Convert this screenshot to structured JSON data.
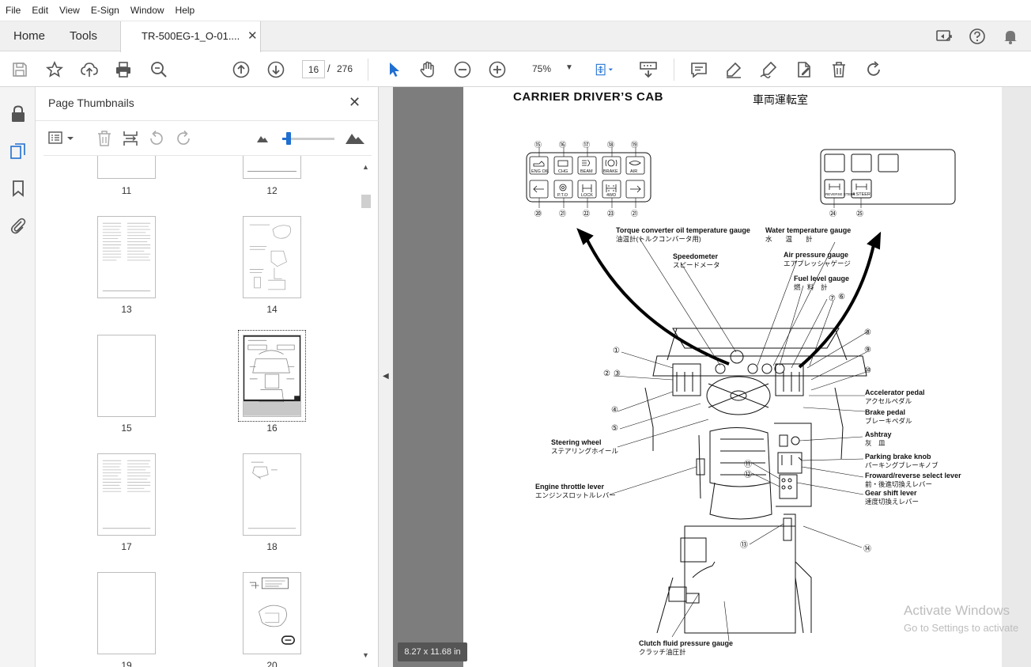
{
  "menu": [
    "File",
    "Edit",
    "View",
    "E-Sign",
    "Window",
    "Help"
  ],
  "tabs": {
    "home": "Home",
    "tools": "Tools",
    "document": "TR-500EG-1_O-01....",
    "close": "✕"
  },
  "toolbar": {
    "page_current": "16",
    "page_separator": "/",
    "page_total": "276",
    "zoom": "75%"
  },
  "thumbnails": {
    "title": "Page Thumbnails",
    "close": "✕",
    "pages": [
      "11",
      "12",
      "13",
      "14",
      "15",
      "16",
      "17",
      "18",
      "19",
      "20"
    ],
    "selected": "16"
  },
  "document": {
    "title_en": "CARRIER DRIVER’S CAB",
    "title_jp": "車両運転室",
    "page_size": "8.27 x 11.68 in",
    "panel_left_top": [
      "ENG OIL",
      "CHG",
      "BEAM",
      "BRAKE",
      "AIR"
    ],
    "panel_left_bottom": [
      "",
      "P.T.O",
      "LOCK",
      "4WD",
      ""
    ],
    "panel_right": [
      "REVERSE STEER",
      "4 STEER"
    ],
    "top_numbers": [
      "⑮",
      "⑯",
      "⑰",
      "⑱",
      "⑲"
    ],
    "bottom_numbers": [
      "⑳",
      "㉑",
      "㉒",
      "㉓",
      "㉑"
    ],
    "right_numbers": [
      "㉔",
      "㉕"
    ],
    "callouts": [
      {
        "en": "Torque converter oil temperature gauge",
        "jp": "油温計(トルクコンバータ用)"
      },
      {
        "en": "Water temperature gauge",
        "jp": "水　　温　　計"
      },
      {
        "en": "Speedometer",
        "jp": "スピードメータ"
      },
      {
        "en": "Air pressure gauge",
        "jp": "エアプレッシャゲージ"
      },
      {
        "en": "Fuel level gauge",
        "jp": "燃　料　計"
      },
      {
        "en": "Accelerator pedal",
        "jp": "アクセルペダル"
      },
      {
        "en": "Brake pedal",
        "jp": "ブレーキペダル"
      },
      {
        "en": "Ashtray",
        "jp": "灰　皿"
      },
      {
        "en": "Parking brake knob",
        "jp": "パーキングブレーキノブ"
      },
      {
        "en": "Froward/reverse select lever",
        "jp": "前・後進切換えレバー"
      },
      {
        "en": "Gear shift lever",
        "jp": "速度切換えレバー"
      },
      {
        "en": "Steering wheel",
        "jp": "ステアリングホイール"
      },
      {
        "en": "Engine throttle lever",
        "jp": "エンジンスロットルレバー"
      },
      {
        "en": "Clutch fluid pressure gauge",
        "jp": "クラッチ油圧計"
      }
    ],
    "markers": [
      "⑦",
      "⑥",
      "⑧",
      "⑨",
      "⑩",
      "①",
      "②",
      "③",
      "④",
      "⑤",
      "⑪",
      "⑫",
      "⑬",
      "⑭"
    ]
  },
  "watermark": {
    "line1": "Activate Windows",
    "line2": "Go to Settings to activate"
  }
}
